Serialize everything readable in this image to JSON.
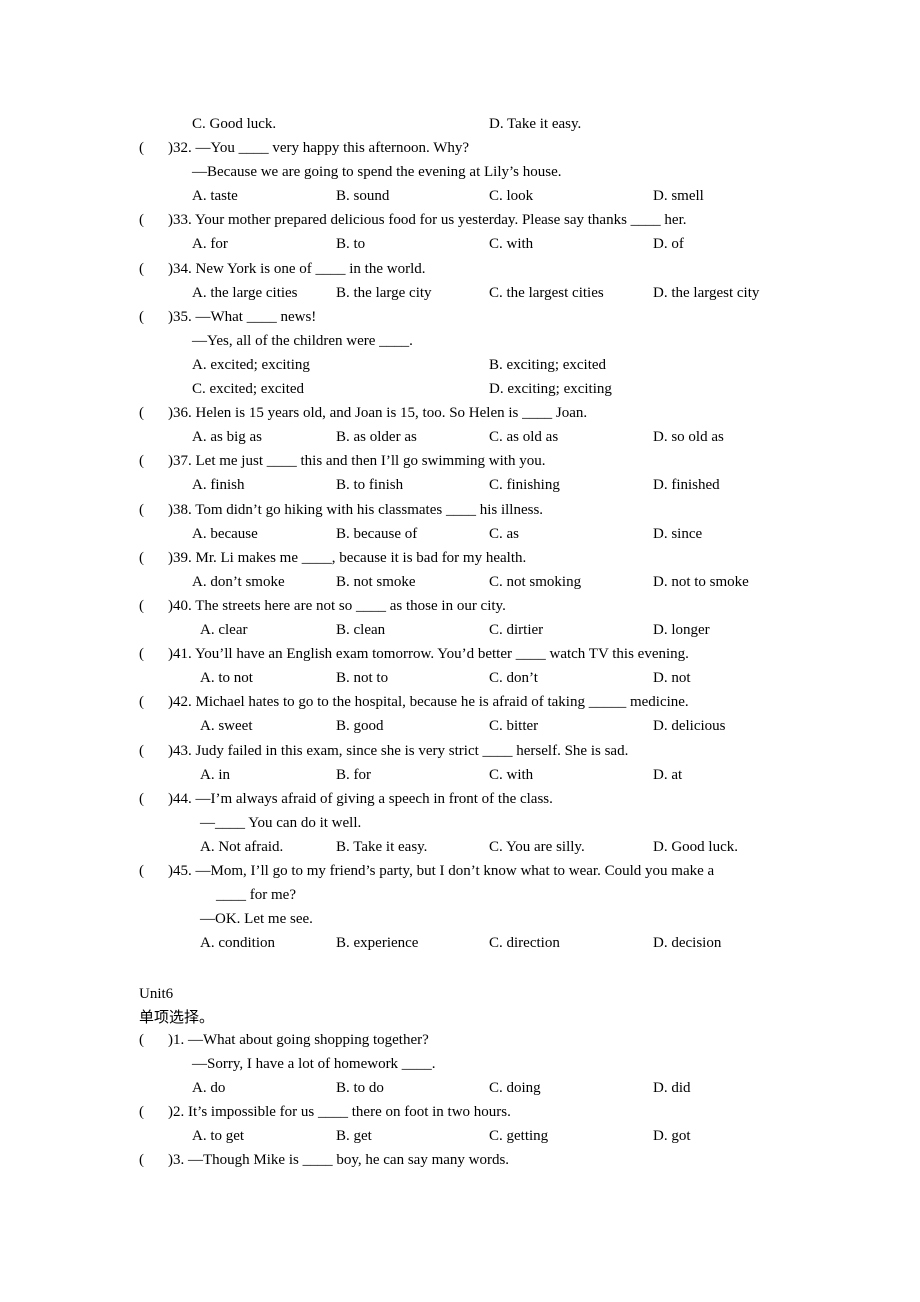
{
  "top_options": {
    "c": "C. Good luck.",
    "d": "D. Take it easy."
  },
  "questions": [
    {
      "num": ")32. —You ____ very happy this afternoon. Why?",
      "extra": [
        "—Because we are going to spend the evening at Lily’s house."
      ],
      "options": [
        "A. taste",
        "B. sound",
        "C. look",
        "D. smell"
      ]
    },
    {
      "num": ")33. Your mother prepared delicious food for us yesterday. Please say thanks ____ her.",
      "extra": [],
      "options": [
        "A. for",
        "B. to",
        "C. with",
        "D. of"
      ]
    },
    {
      "num": ")34. New York is one of ____ in the world.",
      "extra": [],
      "options": [
        "A. the large cities",
        "B. the large city",
        "C. the largest cities",
        "D. the largest city"
      ]
    },
    {
      "num": ")35. —What ____ news!",
      "extra": [
        "—Yes, all of the children were ____."
      ],
      "options": [
        "A. excited; exciting",
        "B. exciting; excited",
        "C. excited; excited",
        "D. exciting; exciting"
      ]
    },
    {
      "num": ")36. Helen is 15 years old, and Joan is 15, too. So Helen is ____ Joan.",
      "extra": [],
      "options": [
        "A. as big as",
        "B. as older as",
        "C. as old as",
        "D. so old as"
      ]
    },
    {
      "num": ")37. Let me just ____ this and then I’ll go swimming with you.",
      "extra": [],
      "options": [
        "A. finish",
        "B. to finish",
        "C. finishing",
        "D. finished"
      ]
    },
    {
      "num": ")38. Tom didn’t go hiking with his classmates ____ his illness.",
      "extra": [],
      "options": [
        "A. because",
        "B. because of",
        "C. as",
        "D. since"
      ]
    },
    {
      "num": ")39. Mr. Li makes me ____, because it is bad for my health.",
      "extra": [],
      "options": [
        "A. don’t smoke",
        "B. not smoke",
        "C. not smoking",
        "D. not to smoke"
      ]
    },
    {
      "num": ")40. The streets here are not so ____ as those in our city.",
      "extra": [],
      "options": [
        "A. clear",
        "B. clean",
        "C. dirtier",
        "D. longer"
      ]
    },
    {
      "num": ")41. You’ll have an English exam tomorrow. You’d better ____ watch TV this evening.",
      "extra": [],
      "options": [
        "A. to not",
        "B. not to",
        "C. don’t",
        "D. not"
      ]
    },
    {
      "num": ")42. Michael hates to go to the hospital, because he is afraid of taking _____ medicine.",
      "extra": [],
      "options": [
        "A. sweet",
        "B. good",
        "C. bitter",
        "D. delicious"
      ]
    },
    {
      "num": ")43. Judy failed in this exam, since she is very strict ____ herself. She is sad.",
      "extra": [],
      "options": [
        "A. in",
        "B. for",
        "C. with",
        "D. at"
      ]
    },
    {
      "num": ")44. —I’m always afraid of giving a speech in front of the class.",
      "extra": [
        "—____ You can do it well."
      ],
      "options": [
        "A. Not afraid.",
        "B. Take it easy.",
        "C. You are silly.",
        "D. Good luck."
      ]
    },
    {
      "num": ")45. —Mom, I’ll go to my friend’s party, but I don’t know what to wear. Could you make a",
      "extra": [
        "____ for me?",
        "—OK. Let me see."
      ],
      "options": [
        "A. condition",
        "B. experience",
        "C. direction",
        "D. decision"
      ]
    }
  ],
  "unit6": {
    "title": "Unit6",
    "subtitle": "单项选择。",
    "questions": [
      {
        "num": ")1. —What about going shopping together?",
        "extra": [
          "—Sorry, I have a lot of homework ____."
        ],
        "options": [
          "A. do",
          "B. to do",
          "C. doing",
          "D. did"
        ]
      },
      {
        "num": ")2. It’s impossible for us ____ there on foot in two hours.",
        "extra": [],
        "options": [
          "A. to get",
          "B. get",
          "C. getting",
          "D. got"
        ]
      },
      {
        "num": ")3. —Though Mike is ____ boy, he can say many words.",
        "extra": [],
        "options": []
      }
    ]
  },
  "paren": "("
}
